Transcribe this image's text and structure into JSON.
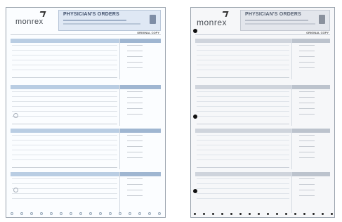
{
  "left_form": {
    "logo": "monrex",
    "title": "PHYSICIAN'S ORDERS",
    "copy_label": "ORIGINAL COPY"
  },
  "right_form": {
    "logo": "monrex",
    "title": "PHYSICIAN'S ORDERS",
    "copy_label": "ORIGINAL COPY"
  }
}
